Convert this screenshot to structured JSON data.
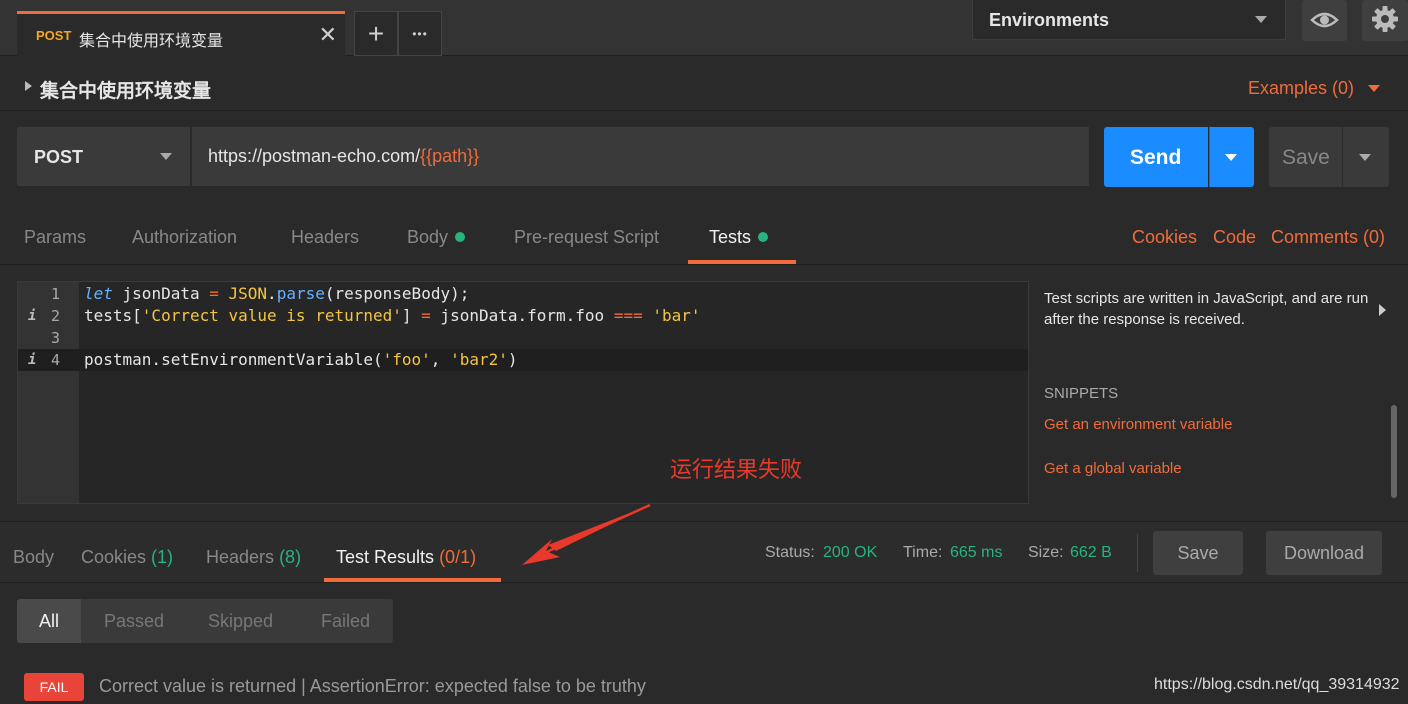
{
  "top_tab": {
    "method": "POST",
    "name": "集合中使用环境变量",
    "close": "✕"
  },
  "topbar": {
    "new_tab": "+",
    "more": "•••",
    "environment": "Environments"
  },
  "request": {
    "title": "集合中使用环境变量",
    "examples": "Examples (0)",
    "method": "POST",
    "url_base": "https://postman-echo.com/",
    "url_var": "{{path}}",
    "send": "Send",
    "save": "Save"
  },
  "req_tabs": {
    "params": "Params",
    "authorization": "Authorization",
    "headers": "Headers",
    "body": "Body",
    "prerequest": "Pre-request Script",
    "tests": "Tests",
    "cookies": "Cookies",
    "code": "Code",
    "comments": "Comments (0)"
  },
  "editor": {
    "lines": [
      {
        "num": "1",
        "info": ""
      },
      {
        "num": "2",
        "info": "i"
      },
      {
        "num": "3",
        "info": ""
      },
      {
        "num": "4",
        "info": "i"
      }
    ],
    "tokens": {
      "l1_kw": "let",
      "l1_a": " jsonData ",
      "l1_eq": "=",
      "l1_sp": " ",
      "l1_gl": "JSON",
      "l1_dot": ".",
      "l1_fn": "parse",
      "l1_b": "(responseBody);",
      "l2_a": "tests[",
      "l2_str": "'Correct value is returned'",
      "l2_b": "] ",
      "l2_eq": "=",
      "l2_c": " jsonData.form.foo ",
      "l2_op": "===",
      "l2_sp": " ",
      "l2_str2": "'bar'",
      "l4_a": "postman.setEnvironmentVariable(",
      "l4_s1": "'foo'",
      "l4_b": ", ",
      "l4_s2": "'bar2'",
      "l4_c": ")"
    }
  },
  "help": {
    "text": "Test scripts are written in JavaScript, and are run after the response is received.",
    "snippets_header": "SNIPPETS",
    "snippets": [
      "Get an environment variable",
      "Get a global variable"
    ]
  },
  "annotation": "运行结果失败",
  "response": {
    "tabs": {
      "body": "Body",
      "cookies": "Cookies",
      "cookies_count": "(1)",
      "headers": "Headers",
      "headers_count": "(8)",
      "test_results": "Test Results",
      "test_results_count": "(0/1)"
    },
    "status_label": "Status:",
    "status_value": "200 OK",
    "time_label": "Time:",
    "time_value": "665 ms",
    "size_label": "Size:",
    "size_value": "662 B",
    "save": "Save",
    "download": "Download"
  },
  "filters": [
    "All",
    "Passed",
    "Skipped",
    "Failed"
  ],
  "result": {
    "badge": "FAIL",
    "text": "Correct value is returned | AssertionError: expected false to be truthy"
  },
  "watermark": "https://blog.csdn.net/qq_39314932",
  "colors": {
    "accent": "#f26b3a",
    "send": "#1a8cff",
    "success": "#26b47f",
    "fail": "#e8443a",
    "annotation": "#e8392b"
  },
  "icons": [
    "close-icon",
    "plus-icon",
    "more-icon",
    "caret-down-icon",
    "eye-icon",
    "gear-icon",
    "triangle-right-icon",
    "info-icon",
    "arrow-annotation-icon"
  ]
}
